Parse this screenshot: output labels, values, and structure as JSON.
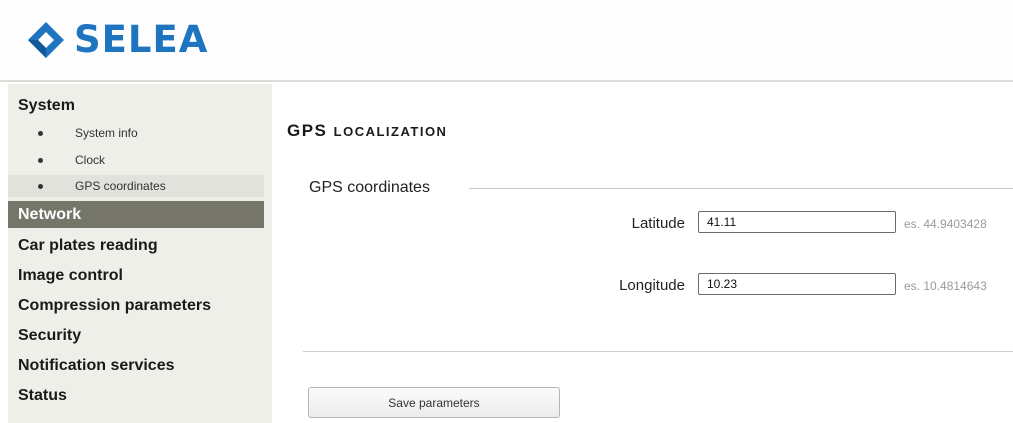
{
  "brand": {
    "name": "SELEA",
    "color": "#1f74c0"
  },
  "sidebar": {
    "system_label": "System",
    "system_items": [
      {
        "label": "System info"
      },
      {
        "label": "Clock"
      },
      {
        "label": "GPS coordinates",
        "active": true
      }
    ],
    "items": [
      {
        "label": "Network",
        "active": true
      },
      {
        "label": "Car plates reading"
      },
      {
        "label": "Image control"
      },
      {
        "label": "Compression parameters"
      },
      {
        "label": "Security"
      },
      {
        "label": "Notification services"
      },
      {
        "label": "Status"
      }
    ]
  },
  "main": {
    "title_first": "GPS",
    "title_rest": "LOCALIZATION",
    "fieldset_legend": "GPS coordinates",
    "latitude": {
      "label": "Latitude",
      "value": "41.11",
      "example": "es. 44.9403428"
    },
    "longitude": {
      "label": "Longitude",
      "value": "10.23",
      "example": "es. 10.4814643"
    },
    "save_label": "Save parameters"
  },
  "colors": {
    "active_nav_bg": "#75756a",
    "sidebar_bg": "#efefea"
  }
}
